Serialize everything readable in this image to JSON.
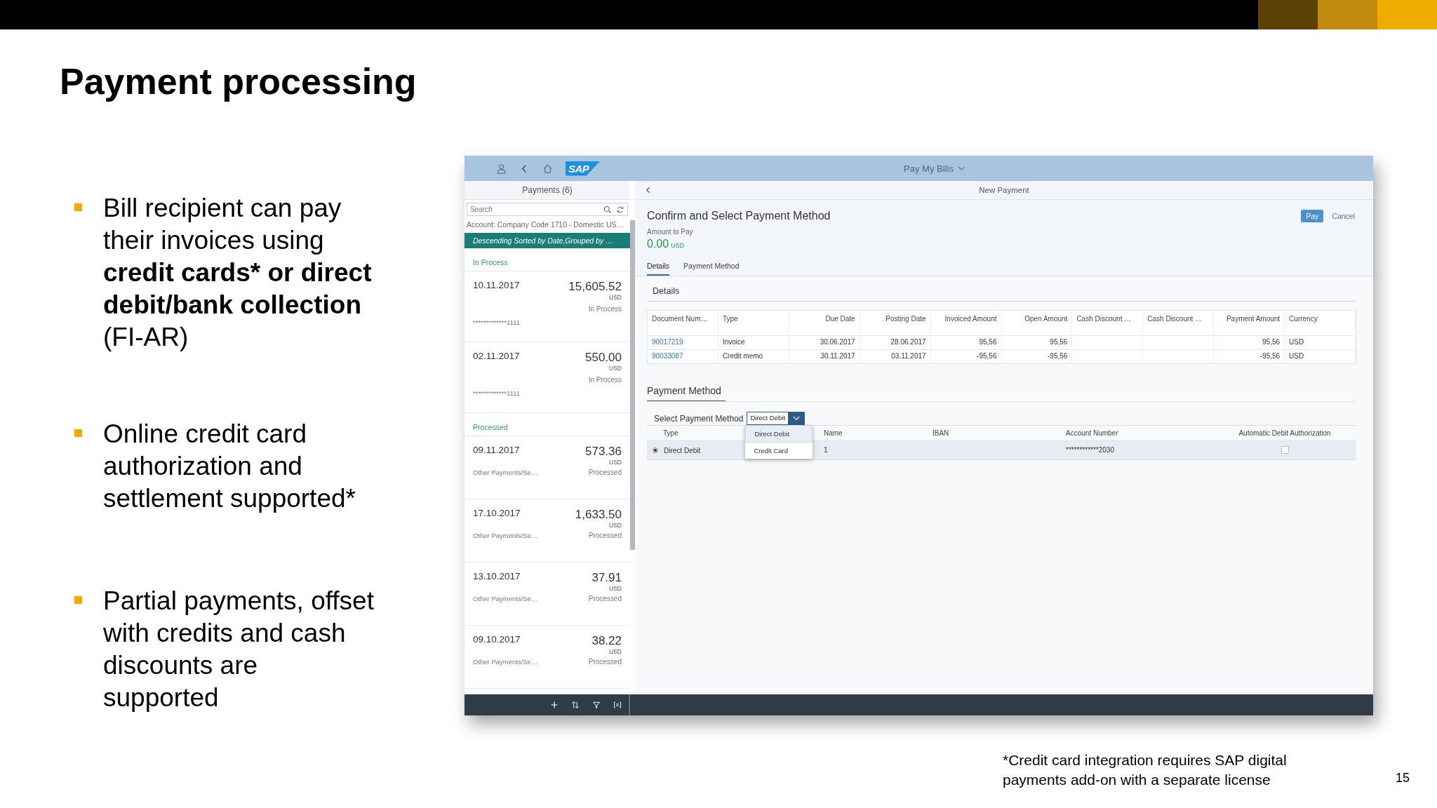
{
  "slide_title": "Payment processing",
  "bullets": [
    {
      "parts": [
        {
          "text": "Bill recipient can pay their invoices using ",
          "bold": false
        },
        {
          "text": "credit cards* or direct debit/bank collection",
          "bold": true
        },
        {
          "text": " (FI-AR)",
          "bold": false
        }
      ]
    },
    {
      "parts": [
        {
          "text": "Online credit card authorization and settlement supported*",
          "bold": false
        }
      ]
    },
    {
      "parts": [
        {
          "text": "Partial payments, offset with credits and cash discounts are supported",
          "bold": false
        }
      ]
    }
  ],
  "app": {
    "header": {
      "logo": "SAP",
      "title": "Pay My Bills"
    },
    "master": {
      "title": "Payments (6)",
      "search": {
        "placeholder": "Search"
      },
      "account": "Account: Company Code 1710 - Domestic US…",
      "sort_info": "Descending Sorted by Date,Grouped by …",
      "groups": [
        {
          "label": "In Process",
          "kind": "stacked",
          "items": [
            {
              "date": "10.11.2017",
              "amount": "15,605.52",
              "currency": "USD",
              "status": "In Process",
              "note": "*************1111"
            },
            {
              "date": "02.11.2017",
              "amount": "550.00",
              "currency": "USD",
              "status": "In Process",
              "note": "*************1111"
            }
          ]
        },
        {
          "label": "Processed",
          "kind": "inline",
          "items": [
            {
              "date": "09.11.2017",
              "amount": "573.36",
              "currency": "USD",
              "status": "Processed",
              "note": "Other Payments/Se…"
            },
            {
              "date": "17.10.2017",
              "amount": "1,633.50",
              "currency": "USD",
              "status": "Processed",
              "note": "Other Payments/Se…"
            },
            {
              "date": "13.10.2017",
              "amount": "37.91",
              "currency": "USD",
              "status": "Processed",
              "note": "Other Payments/Se…"
            },
            {
              "date": "09.10.2017",
              "amount": "38.22",
              "currency": "USD",
              "status": "Processed",
              "note": "Other Payments/Se…"
            }
          ]
        }
      ]
    },
    "detail": {
      "nav_title": "New Payment",
      "title": "Confirm and Select Payment Method",
      "amount_label": "Amount to Pay",
      "amount": "0.00",
      "amount_currency": "USD",
      "buttons": [
        {
          "label": "Pay",
          "kind": "primary"
        },
        {
          "label": "Cancel",
          "kind": "plain"
        }
      ],
      "tabs": [
        {
          "label": "Details",
          "selected": true
        },
        {
          "label": "Payment Method",
          "selected": false
        }
      ],
      "details_section": "Details",
      "table": {
        "columns": [
          {
            "label": "Document Num…",
            "kind": "link"
          },
          {
            "label": "Type",
            "kind": "text"
          },
          {
            "label": "Due Date",
            "kind": "number"
          },
          {
            "label": "Posting Date",
            "kind": "number"
          },
          {
            "label": "Invoiced Amount",
            "kind": "number"
          },
          {
            "label": "Open Amount",
            "kind": "number"
          },
          {
            "label": "Cash Discount …",
            "kind": "text"
          },
          {
            "label": "Cash Discount …",
            "kind": "text"
          },
          {
            "label": "Payment Amount",
            "kind": "number"
          },
          {
            "label": "Currency",
            "kind": "text"
          }
        ],
        "rows": [
          [
            "90017219",
            "Invoice",
            "30.06.2017",
            "28.06.2017",
            "95,56",
            "95,56",
            "",
            "",
            "95,56",
            "USD"
          ],
          [
            "90033087",
            "Credit memo",
            "30.11.2017",
            "03.11.2017",
            "-95,56",
            "-95,56",
            "",
            "",
            "-95,56",
            "USD"
          ]
        ]
      },
      "payment_section": "Payment Method",
      "select_label": "Select Payment Method",
      "select_value": "Direct Debit",
      "dropdown": [
        {
          "label": "Direct Debit",
          "selected": true
        },
        {
          "label": "Credit Card",
          "selected": false
        }
      ],
      "method_table": {
        "columns": [
          "Type",
          "Name",
          "IBAN",
          "Account Number",
          "Automatic Debit Authorization"
        ],
        "rows": [
          {
            "selected": true,
            "type": "Direct Debit",
            "name": "1",
            "account": "************2030",
            "auto_debit": false
          }
        ]
      }
    }
  },
  "footnote": "*Credit card integration requires SAP digital payments add-on with a separate license",
  "page_number": "15"
}
